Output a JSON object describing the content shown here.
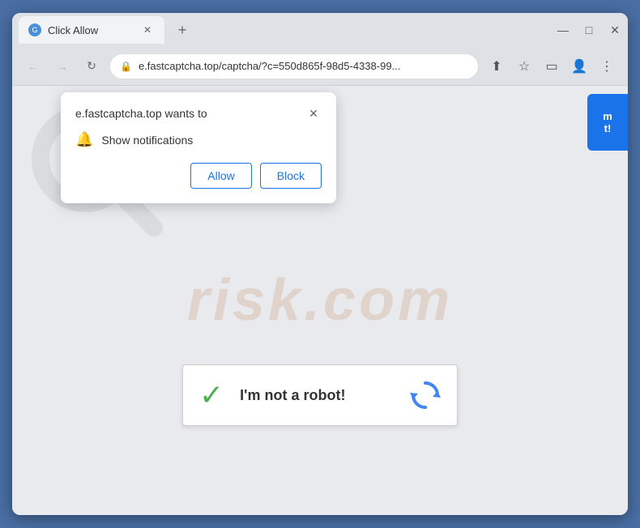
{
  "browser": {
    "tab": {
      "favicon_label": "G",
      "title": "Click Allow",
      "close_label": "✕"
    },
    "new_tab_label": "+",
    "window_controls": {
      "minimize": "—",
      "maximize": "□",
      "close": "✕"
    },
    "nav": {
      "back_label": "←",
      "forward_label": "→",
      "reload_label": "↻",
      "address": "e.fastcaptcha.top/captcha/?c=550d865f-98d5-4338-99...",
      "share_label": "⬆",
      "bookmark_label": "☆",
      "sidebar_label": "▭",
      "profile_label": "👤",
      "menu_label": "⋮"
    }
  },
  "notification_popup": {
    "title": "e.fastcaptcha.top wants to",
    "close_label": "✕",
    "notification_text": "Show notifications",
    "allow_label": "Allow",
    "block_label": "Block"
  },
  "captcha": {
    "label": "I'm not a robot!",
    "checkmark": "✓"
  },
  "watermark": {
    "text": "risk.com"
  },
  "blue_button": {
    "line1": "m",
    "line2": "t!"
  }
}
